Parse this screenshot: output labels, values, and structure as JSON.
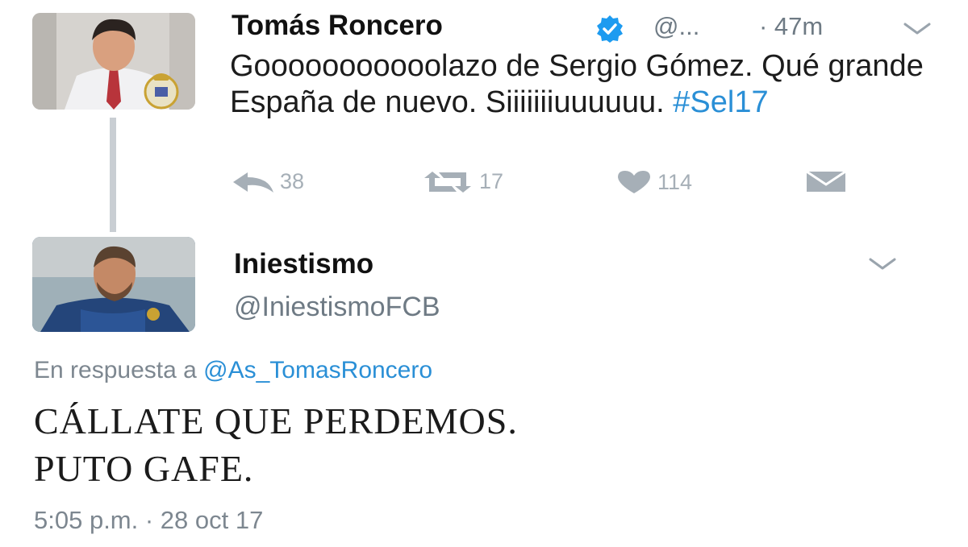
{
  "tweet1": {
    "author_name": "Tomás Roncero",
    "handle": "@...",
    "time": "· 47m",
    "text_before_hashtag": "Gooooooooooolazo de Sergio Gómez. Qué grande España de nuevo. Siiiiiiiuuuuuu.",
    "hashtag": "#Sel17",
    "counts": {
      "replies": "38",
      "retweets": "17",
      "likes": "114"
    },
    "icons": [
      "verified-badge-icon",
      "chevron-down-icon",
      "reply-icon",
      "retweet-icon",
      "heart-icon",
      "envelope-icon"
    ]
  },
  "tweet2": {
    "author_name": "Iniestismo",
    "handle": "@IniestismoFCB",
    "reply_prefix": "En respuesta a",
    "reply_mention": "@As_TomasRoncero",
    "text_line1": "CÁLLATE QUE PERDEMOS.",
    "text_line2": "PUTO GAFE.",
    "timestamp": "5:05 p.m. · 28 oct 17"
  },
  "colors": {
    "link": "#2a8fd6",
    "muted": "#6e7a84",
    "action_icons": "#a6afb7",
    "verified": "#1d9bf0"
  }
}
